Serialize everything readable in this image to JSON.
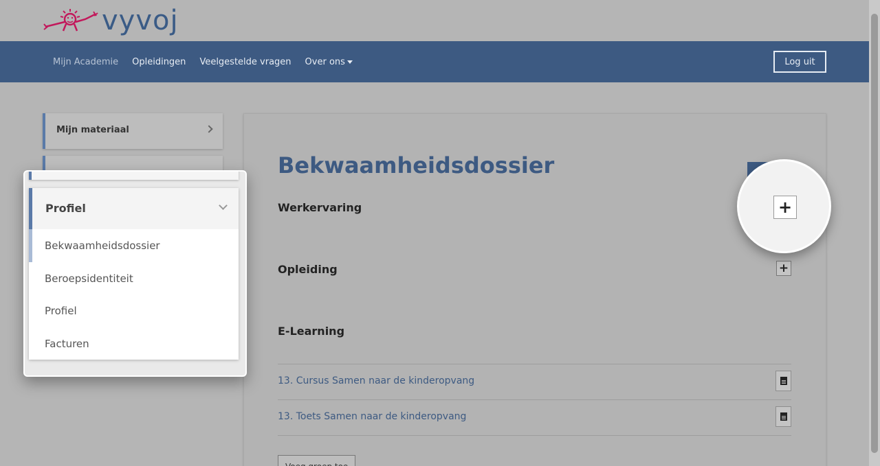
{
  "brand": {
    "logo_text": "vyvoj"
  },
  "nav": {
    "items": [
      {
        "label": "Mijn Academie"
      },
      {
        "label": "Opleidingen"
      },
      {
        "label": "Veelgestelde vragen"
      },
      {
        "label": "Over ons"
      }
    ],
    "logout_label": "Log uit"
  },
  "sidebar": {
    "material_label": "Mijn materiaal"
  },
  "profile_menu": {
    "header_label": "Profiel",
    "items": [
      {
        "label": "Bekwaamheidsdossier"
      },
      {
        "label": "Beroepsidentiteit"
      },
      {
        "label": "Profiel"
      },
      {
        "label": "Facturen"
      }
    ]
  },
  "main": {
    "title": "Bekwaamheidsdossier",
    "sections": {
      "werkervaring": "Werkervaring",
      "opleiding": "Opleiding",
      "elearning": "E-Learning"
    },
    "elearning_items": [
      {
        "label": "13. Cursus Samen naar de kinderopvang"
      },
      {
        "label": "13. Toets Samen naar de kinderopvang"
      }
    ],
    "bottom_button_label": "Voeg groep toe"
  },
  "icons": {
    "add": "plus-icon",
    "document": "document-icon",
    "chevron_right": "chevron-right-icon",
    "chevron_down": "chevron-down-icon"
  },
  "colors": {
    "brand_blue": "#3d5a82",
    "logo_pink": "#c2185b",
    "accent_bar": "#5a7aa8"
  }
}
